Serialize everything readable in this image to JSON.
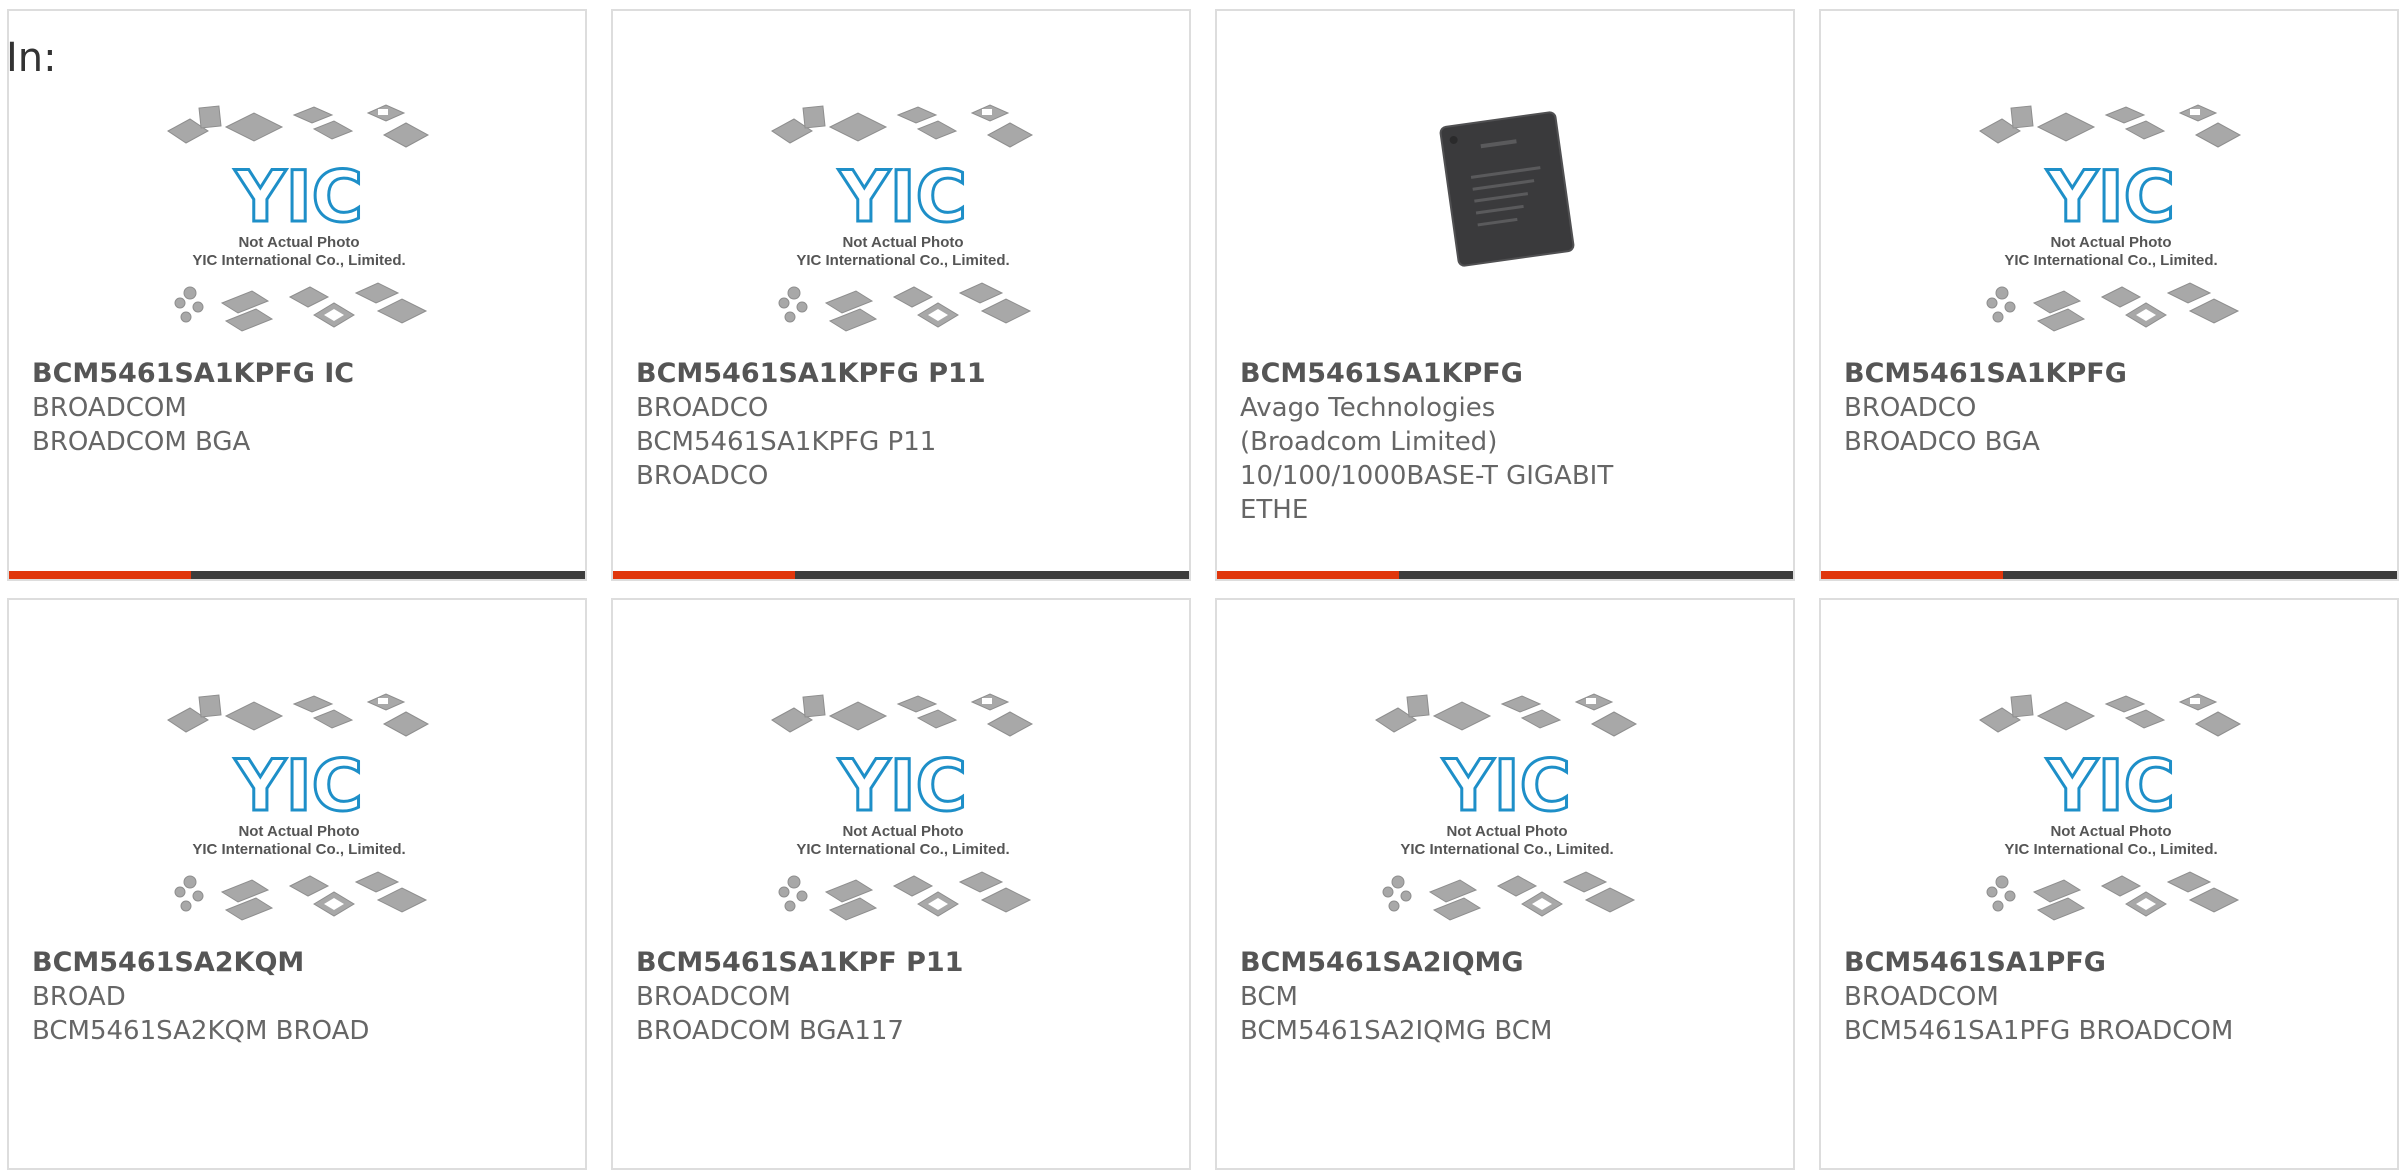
{
  "header": {
    "label": "In:"
  },
  "thumbnail": {
    "caption_line1": "Not Actual Photo",
    "caption_line2": "YIC International Co., Limited.",
    "logo_text": "YIC"
  },
  "colors": {
    "accent": "#e0360c",
    "bar": "#3c3c3c",
    "logo": "#1e8fc8"
  },
  "products": [
    {
      "part_number": "BCM5461SA1KPFG IC",
      "manufacturer": "BROADCOM",
      "description": "BROADCOM BGA",
      "image": "placeholder"
    },
    {
      "part_number": "BCM5461SA1KPFG P11",
      "manufacturer": "BROADCO",
      "description": "BCM5461SA1KPFG P11 BROADCO",
      "image": "placeholder"
    },
    {
      "part_number": "BCM5461SA1KPFG",
      "manufacturer": "Avago Technologies (Broadcom Limited)",
      "description": "10/100/1000BASE-T GIGABIT ETHE",
      "image": "chip-photo"
    },
    {
      "part_number": "BCM5461SA1KPFG",
      "manufacturer": "BROADCO",
      "description": "BROADCO BGA",
      "image": "placeholder"
    },
    {
      "part_number": "BCM5461SA2KQM",
      "manufacturer": "BROAD",
      "description": "BCM5461SA2KQM BROAD",
      "image": "placeholder"
    },
    {
      "part_number": "BCM5461SA1KPF P11",
      "manufacturer": "BROADCOM",
      "description": "BROADCOM BGA117",
      "image": "placeholder"
    },
    {
      "part_number": "BCM5461SA2IQMG",
      "manufacturer": "BCM",
      "description": "BCM5461SA2IQMG BCM",
      "image": "placeholder"
    },
    {
      "part_number": "BCM5461SA1PFG",
      "manufacturer": "BROADCOM",
      "description": "BCM5461SA1PFG BROADCOM",
      "image": "placeholder"
    }
  ]
}
